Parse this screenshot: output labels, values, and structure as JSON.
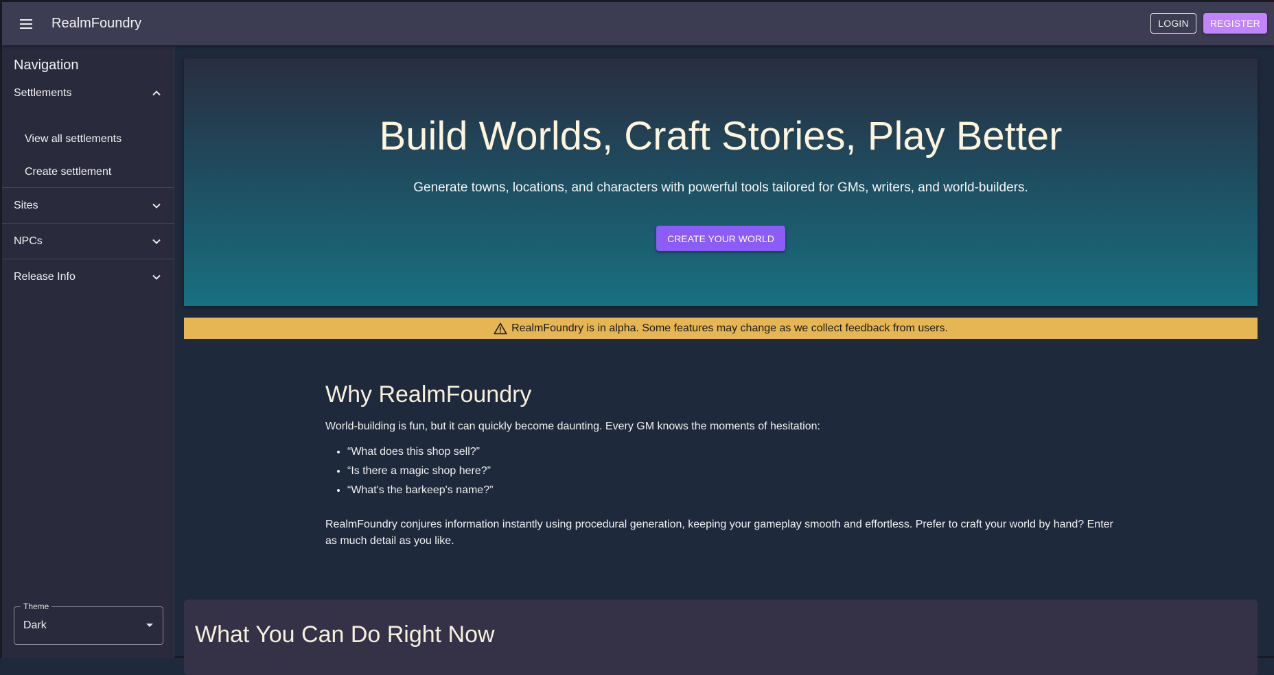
{
  "app": {
    "title": "RealmFoundry"
  },
  "header": {
    "login_label": "LOGIN",
    "register_label": "REGISTER"
  },
  "sidebar": {
    "heading": "Navigation",
    "sections": [
      {
        "label": "Settlements",
        "expanded": true,
        "items": [
          "View all settlements",
          "Create settlement"
        ]
      },
      {
        "label": "Sites",
        "expanded": false
      },
      {
        "label": "NPCs",
        "expanded": false
      },
      {
        "label": "Release Info",
        "expanded": false
      }
    ],
    "theme": {
      "label": "Theme",
      "value": "Dark"
    }
  },
  "hero": {
    "title": "Build Worlds, Craft Stories, Play Better",
    "subtitle": "Generate towns, locations, and characters with powerful tools tailored for GMs, writers, and world-builders.",
    "cta": "CREATE YOUR WORLD"
  },
  "alert": {
    "icon": "warning-icon",
    "text": "RealmFoundry is in alpha. Some features may change as we collect feedback from users."
  },
  "why": {
    "heading": "Why RealmFoundry",
    "intro": "World-building is fun, but it can quickly become daunting. Every GM knows the moments of hesitation:",
    "questions": [
      "“What does this shop sell?”",
      "“Is there a magic shop here?”",
      "“What's the barkeep's name?”"
    ],
    "outro": "RealmFoundry conjures information instantly using procedural generation, keeping your gameplay smooth and effortless. Prefer to craft your world by hand? Enter as much detail as you like."
  },
  "features": {
    "heading": "What You Can Do Right Now"
  },
  "colors": {
    "appbar": "#3c3c52",
    "sidebar": "#2a2a3d",
    "background": "#1e293b",
    "accent": "#8b5cf6",
    "register": "#c084fc",
    "alert": "#e6b655"
  }
}
